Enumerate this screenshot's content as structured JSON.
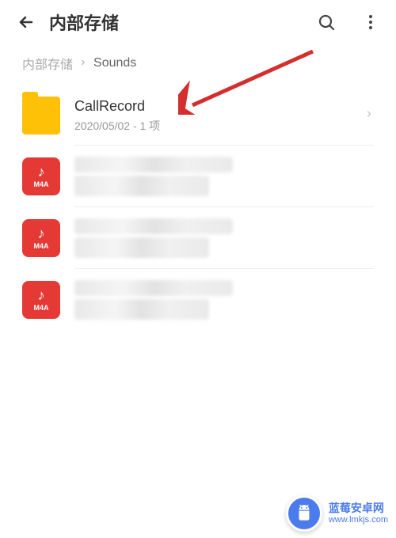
{
  "header": {
    "title": "内部存储"
  },
  "breadcrumb": {
    "root": "内部存储",
    "current": "Sounds"
  },
  "items": [
    {
      "type": "folder",
      "name": "CallRecord",
      "subtitle": "2020/05/02 - 1 项"
    },
    {
      "type": "m4a",
      "icon_label": "M4A"
    },
    {
      "type": "m4a",
      "icon_label": "M4A"
    },
    {
      "type": "m4a",
      "icon_label": "M4A"
    }
  ],
  "watermark": {
    "title": "蓝莓安卓网",
    "url": "www.lmkjs.com"
  }
}
